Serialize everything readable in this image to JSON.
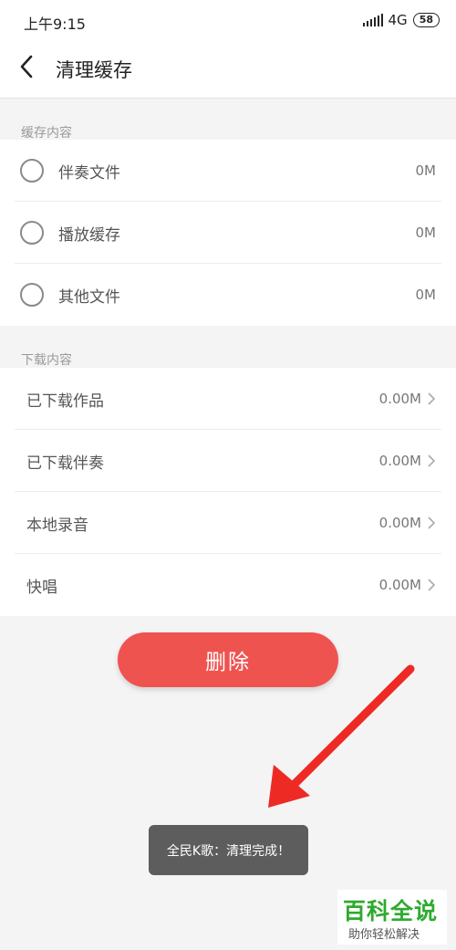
{
  "status_bar": {
    "time": "上午9:15",
    "network": "4G",
    "battery": "58"
  },
  "nav": {
    "title": "清理缓存",
    "back_icon": "chevron-left-icon"
  },
  "cache_section": {
    "label": "缓存内容",
    "items": [
      {
        "label": "伴奏文件",
        "size": "0M"
      },
      {
        "label": "播放缓存",
        "size": "0M"
      },
      {
        "label": "其他文件",
        "size": "0M"
      }
    ]
  },
  "download_section": {
    "label": "下载内容",
    "items": [
      {
        "label": "已下载作品",
        "size": "0.00M"
      },
      {
        "label": "已下载伴奏",
        "size": "0.00M"
      },
      {
        "label": "本地录音",
        "size": "0.00M"
      },
      {
        "label": "快唱",
        "size": "0.00M"
      }
    ]
  },
  "delete_button": {
    "label": "删除"
  },
  "toast": {
    "text": "全民K歌：清理完成！"
  },
  "watermark": {
    "title": "百科全说",
    "subtitle": "助你轻松解决"
  },
  "colors": {
    "accent": "#ef5350",
    "arrow": "#ee2a24",
    "watermark": "#2eaa2e"
  }
}
